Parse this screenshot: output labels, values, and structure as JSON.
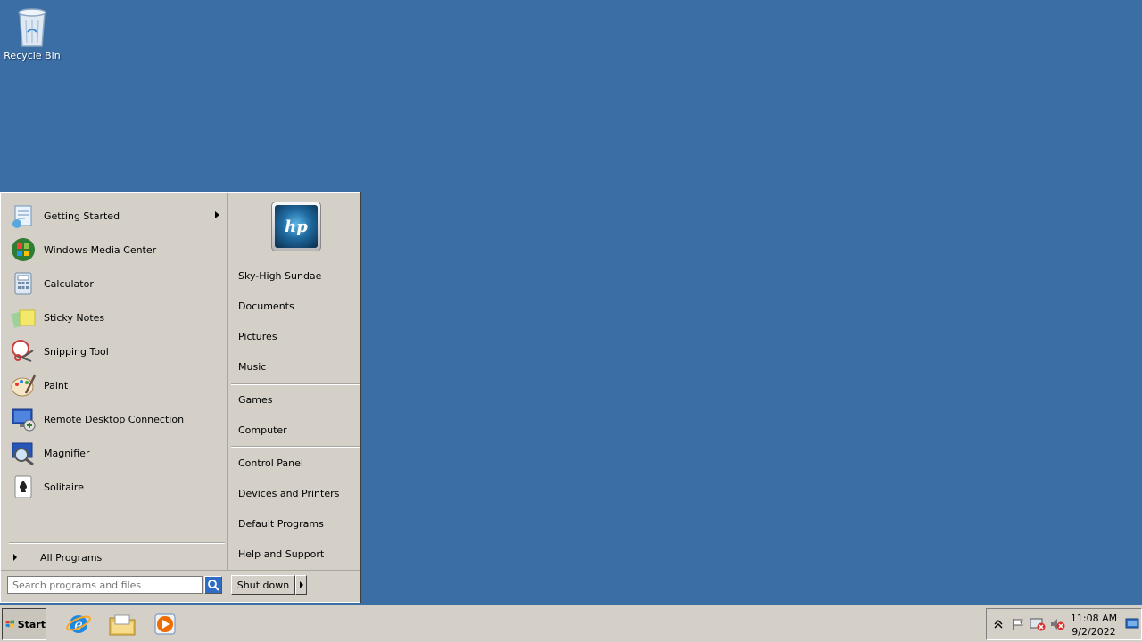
{
  "desktop": {
    "icons": [
      {
        "label": "Recycle Bin",
        "icon": "recycle-bin-icon"
      }
    ]
  },
  "start_menu": {
    "programs": [
      {
        "label": "Getting Started",
        "icon": "getting-started-icon",
        "has_submenu": true
      },
      {
        "label": "Windows Media Center",
        "icon": "windows-media-center-icon"
      },
      {
        "label": "Calculator",
        "icon": "calculator-icon"
      },
      {
        "label": "Sticky Notes",
        "icon": "sticky-notes-icon"
      },
      {
        "label": "Snipping Tool",
        "icon": "snipping-tool-icon"
      },
      {
        "label": "Paint",
        "icon": "paint-icon"
      },
      {
        "label": "Remote Desktop Connection",
        "icon": "remote-desktop-icon"
      },
      {
        "label": "Magnifier",
        "icon": "magnifier-icon"
      },
      {
        "label": "Solitaire",
        "icon": "solitaire-icon"
      }
    ],
    "all_programs_label": "All Programs",
    "search_placeholder": "Search programs and files",
    "right_items": {
      "user": "Sky-High Sundae",
      "documents": "Documents",
      "pictures": "Pictures",
      "music": "Music",
      "games": "Games",
      "computer": "Computer",
      "control_panel": "Control Panel",
      "devices": "Devices and Printers",
      "default_programs": "Default Programs",
      "help": "Help and Support"
    },
    "shutdown_label": "Shut down",
    "user_picture": "hp-logo-icon",
    "user_picture_text": "hp"
  },
  "taskbar": {
    "start_label": "Start",
    "pinned": [
      "internet-explorer-icon",
      "windows-explorer-icon",
      "media-player-icon"
    ],
    "tray_icons": [
      "show-hidden-icons-chevron",
      "action-center-flag-icon",
      "network-error-icon",
      "volume-muted-icon"
    ],
    "time": "11:08 AM",
    "date": "9/2/2022"
  },
  "colors": {
    "desktop": "#3a6ea5",
    "menu": "#d4d0c8"
  }
}
